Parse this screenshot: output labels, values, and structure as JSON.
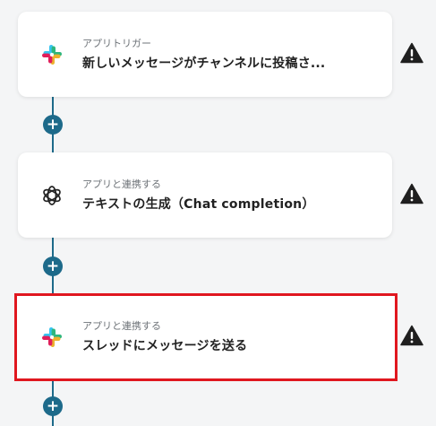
{
  "steps": [
    {
      "caption": "アプリトリガー",
      "title": "新しいメッセージがチャンネルに投稿さ...",
      "icon": "slack-icon",
      "warning_icon": "warning-icon"
    },
    {
      "caption": "アプリと連携する",
      "title": "テキストの生成（Chat completion）",
      "icon": "openai-icon",
      "warning_icon": "warning-icon"
    },
    {
      "caption": "アプリと連携する",
      "title": "スレッドにメッセージを送る",
      "icon": "slack-icon",
      "warning_icon": "warning-icon",
      "selected": true
    }
  ],
  "add_step_button": {
    "label": "+",
    "icon": "plus-icon"
  },
  "colors": {
    "connector": "#1d6a8a",
    "selection_border": "#e0171f",
    "warning": "#1f1f1f",
    "background": "#f4f5f6"
  }
}
